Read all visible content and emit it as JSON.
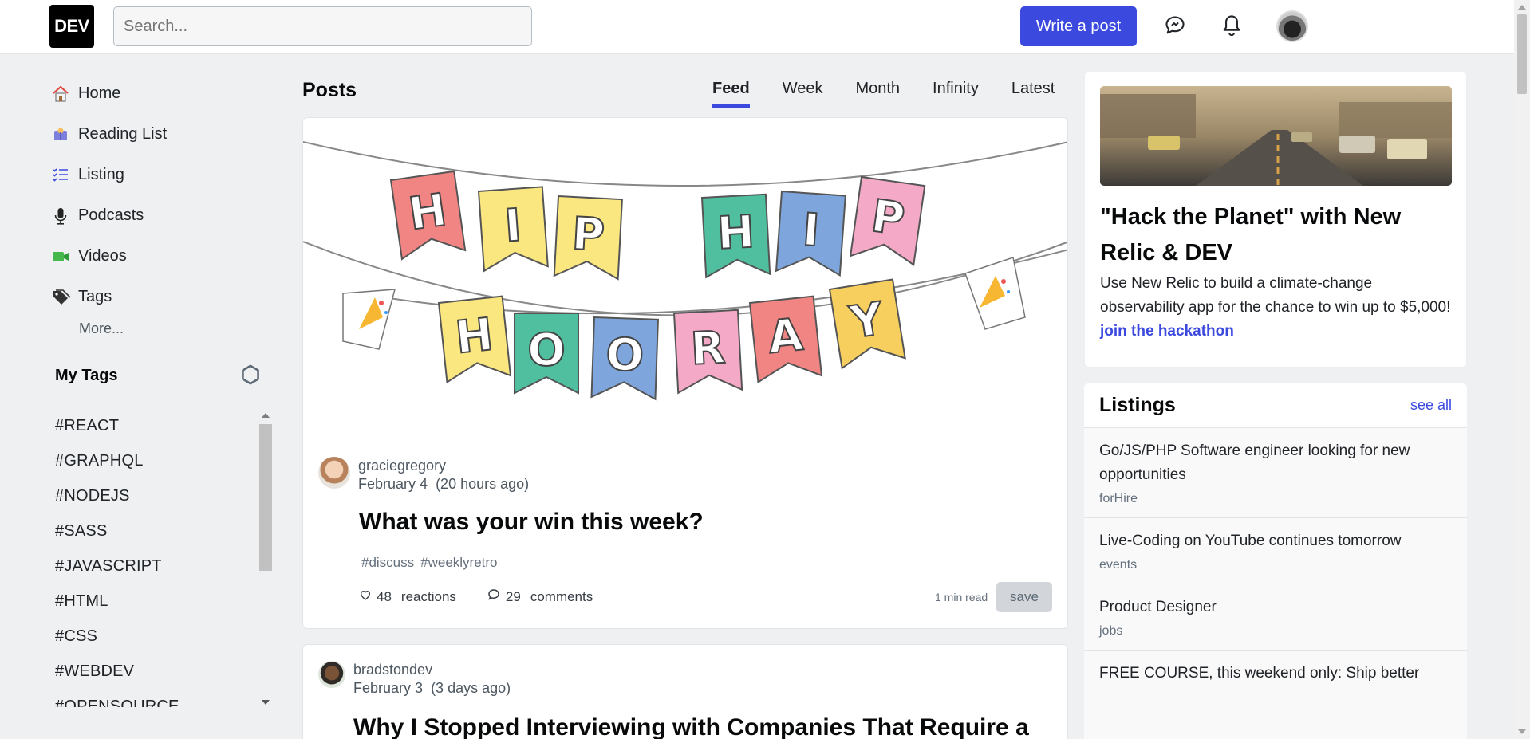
{
  "header": {
    "logo_text": "DEV",
    "search_placeholder": "Search...",
    "write_post_label": "Write a post"
  },
  "sidebar": {
    "items": [
      {
        "label": "Home",
        "icon": "home-icon"
      },
      {
        "label": "Reading List",
        "icon": "reading-list-icon"
      },
      {
        "label": "Listing",
        "icon": "listing-icon"
      },
      {
        "label": "Podcasts",
        "icon": "microphone-icon"
      },
      {
        "label": "Videos",
        "icon": "video-camera-icon"
      },
      {
        "label": "Tags",
        "icon": "tags-icon"
      }
    ],
    "more_label": "More...",
    "my_tags_title": "My Tags",
    "tags": [
      "#REACT",
      "#GRAPHQL",
      "#NODEJS",
      "#SASS",
      "#JAVASCRIPT",
      "#HTML",
      "#CSS",
      "#WEBDEV",
      "#OPENSOURCE"
    ]
  },
  "feed": {
    "title": "Posts",
    "tabs": [
      "Feed",
      "Week",
      "Month",
      "Infinity",
      "Latest"
    ],
    "active_tab": "Feed",
    "posts": [
      {
        "banner_letters_top": [
          "H",
          "I",
          "P",
          "H",
          "I",
          "P"
        ],
        "banner_letters_bottom": [
          "H",
          "O",
          "O",
          "R",
          "A",
          "Y"
        ],
        "author": "graciegregory",
        "date": "February 4",
        "relative": "(20 hours ago)",
        "title": "What was your win this week?",
        "tags": [
          "#discuss",
          "#weeklyretro"
        ],
        "reactions_count": "48",
        "reactions_label": "reactions",
        "comments_count": "29",
        "comments_label": "comments",
        "read_time": "1 min read",
        "save_label": "save"
      },
      {
        "author": "bradstondev",
        "date": "February 3",
        "relative": "(3 days ago)",
        "title": "Why I Stopped Interviewing with Companies That Require a"
      }
    ]
  },
  "promo": {
    "title": "\"Hack the Planet\" with New Relic & DEV",
    "text": "Use New Relic to build a climate-change observability app for the chance to win up to $5,000!",
    "link_label": "join the hackathon"
  },
  "listings": {
    "title": "Listings",
    "see_all": "see all",
    "items": [
      {
        "title": "Go/JS/PHP Software engineer looking for new opportunities",
        "category": "forHire"
      },
      {
        "title": "Live-Coding on YouTube continues tomorrow",
        "category": "events"
      },
      {
        "title": "Product Designer",
        "category": "jobs"
      },
      {
        "title": "FREE COURSE, this weekend only: Ship better",
        "category": ""
      }
    ]
  },
  "colors": {
    "accent": "#3b49df",
    "background": "#eef0f1",
    "flag_red": "#f08583",
    "flag_yellow": "#fbe77f",
    "flag_green": "#4fbfa0",
    "flag_blue": "#7ea6dc",
    "flag_pink": "#f4a9c6",
    "flag_orange": "#f7cf5f"
  }
}
